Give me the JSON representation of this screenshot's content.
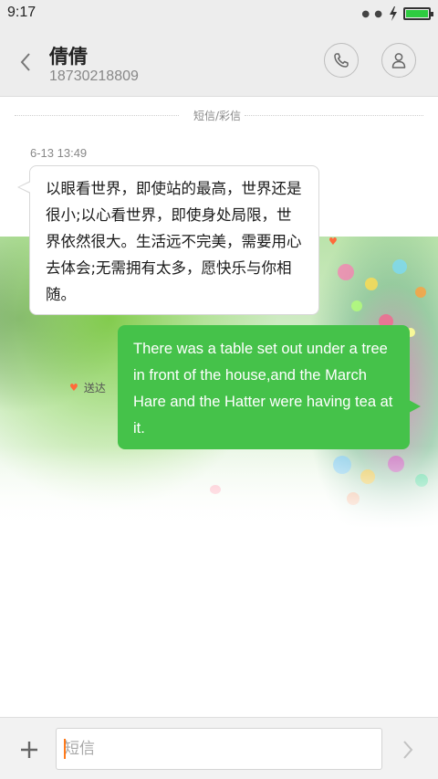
{
  "status_bar": {
    "time": "9:17",
    "battery_level": 1.0,
    "battery_color": "#2ecc40"
  },
  "header": {
    "contact_name": "倩倩",
    "contact_number": "18730218809",
    "back_icon": "chevron-left-icon",
    "call_icon": "phone-icon",
    "contact_icon": "person-icon"
  },
  "conversation": {
    "channel_label": "短信/彩信",
    "timestamp": "6-13 13:49",
    "messages": [
      {
        "direction": "incoming",
        "text": "以眼看世界，即使站的最高，世界还是很小;以心看世界，即使身处局限，世界依然很大。生活远不完美，需要用心去体会;无需拥有太多，愿快乐与你相随。"
      },
      {
        "direction": "outgoing",
        "text": "There was a table set out under a tree in front of the house,and the March Hare and the Hatter were having tea at it.",
        "bubble_color": "#45c24a"
      }
    ],
    "delivery_status": "送达"
  },
  "composer": {
    "placeholder": "短信",
    "add_icon": "plus-icon",
    "send_icon": "chevron-right-icon"
  }
}
